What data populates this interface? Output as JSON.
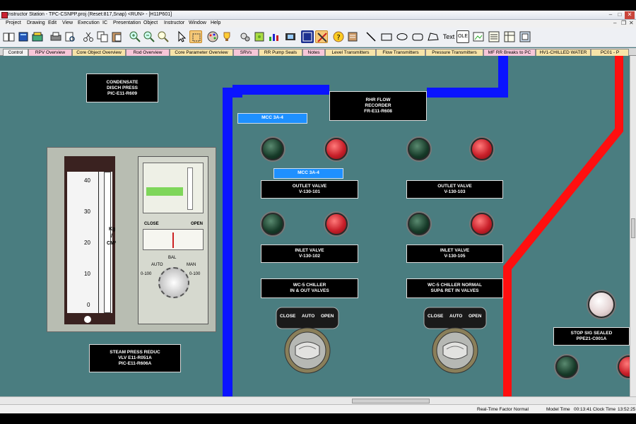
{
  "window": {
    "title": "Instructor Station - TPC-CSNPP.proj (Reset:817,Snap) <RUN> - [H11P601]",
    "minimize_glyph": "–",
    "maximize_glyph": "□",
    "close_glyph": "✕"
  },
  "menu": {
    "items": [
      "Project",
      "Drawing",
      "Edit",
      "View",
      "Execution",
      "IC",
      "Presentation",
      "Object",
      "Instructor",
      "Window",
      "Help"
    ],
    "right_glyphs": [
      "–",
      "❐",
      "✕"
    ]
  },
  "toolbar": {
    "text_tool_label": "Text",
    "ole_tool_label": "OLE"
  },
  "tabs": [
    {
      "label": "Control",
      "color": "#f2f2f2"
    },
    {
      "label": "RPV Overview",
      "color": "#f7c6d8"
    },
    {
      "label": "Core Object Overview",
      "color": "#f7e3a8"
    },
    {
      "label": "Rod Overview",
      "color": "#f7c6d8"
    },
    {
      "label": "Core Parameter Overview",
      "color": "#f7e3a8"
    },
    {
      "label": "SRVs",
      "color": "#f7c6d8"
    },
    {
      "label": "RR Pump Seals",
      "color": "#f7e3a8"
    },
    {
      "label": "Notes",
      "color": "#f7c6d8"
    },
    {
      "label": "Level Transmitters",
      "color": "#f7e3a8"
    },
    {
      "label": "Flow Transmitters",
      "color": "#f7e3a8"
    },
    {
      "label": "Pressure Transmitters",
      "color": "#f7e3a8"
    },
    {
      "label": "MF RR Breaks to PC",
      "color": "#f7c6d8"
    },
    {
      "label": "HV1-CHILLED WATER",
      "color": "#f7e3a8"
    },
    {
      "label": "PC01 - P",
      "color": "#f7e3a8"
    }
  ],
  "panel": {
    "labels": {
      "condensate_line1": "CONDENSATE",
      "condensate_line2": "DISCH PRESS",
      "condensate_line3": "PIC-E11-R609",
      "rhr_line1": "RHR FLOW",
      "rhr_line2": "RECORDER",
      "rhr_line3": "FR-E11-R608",
      "mcc_a": "MCC 3A-4",
      "mcc_b": "MCC 3A-4",
      "outlet_101_line1": "OUTLET VALVE",
      "outlet_101_line2": "V-130-101",
      "outlet_103_line1": "OUTLET VALVE",
      "outlet_103_line2": "V-130-103",
      "inlet_102_line1": "INLET VALVE",
      "inlet_102_line2": "V-130-102",
      "inlet_105_line1": "INLET VALVE",
      "inlet_105_line2": "V-130-105",
      "wc5_left_line1": "WC-5 CHILLER",
      "wc5_left_line2": "IN & OUT VALVES",
      "wc5_right_line1": "WC-5 CHILLER NORMAL",
      "wc5_right_line2": "SUP& RET IN VALVES",
      "steam_line1": "STEAM PRESS REDUC",
      "steam_line2": "VLV E11-R051A",
      "steam_line3": "PIC-E11-R606A",
      "stop_line1": "STOP SIG SEALED",
      "stop_line2": "PPE21-C001A"
    },
    "gauge": {
      "ticks": [
        "40",
        "30",
        "20",
        "10",
        "0"
      ],
      "unit_top": "Kg",
      "unit_slash": "/",
      "unit_bottom": "CM²",
      "close_label": "CLOSE",
      "open_label": "OPEN",
      "bal_label": "BAL",
      "auto_label": "AUTO",
      "man_label": "MAN",
      "range_left": "0-100",
      "range_right": "0-100"
    },
    "switch_labels": {
      "close": "CLOSE",
      "auto": "AUTO",
      "open": "OPEN"
    }
  },
  "status": {
    "rtf_label": "Real-Time Factor",
    "rtf_value": "Normal",
    "model_time_label": "Model Time",
    "model_time_value": "00:13:41",
    "clock_time_label": "Clock Time",
    "clock_time_value": "13:52:25"
  },
  "colors": {
    "panel_bg": "#4a7d80",
    "blue_line": "#0a14ff",
    "red_line": "#ff0f0f"
  }
}
